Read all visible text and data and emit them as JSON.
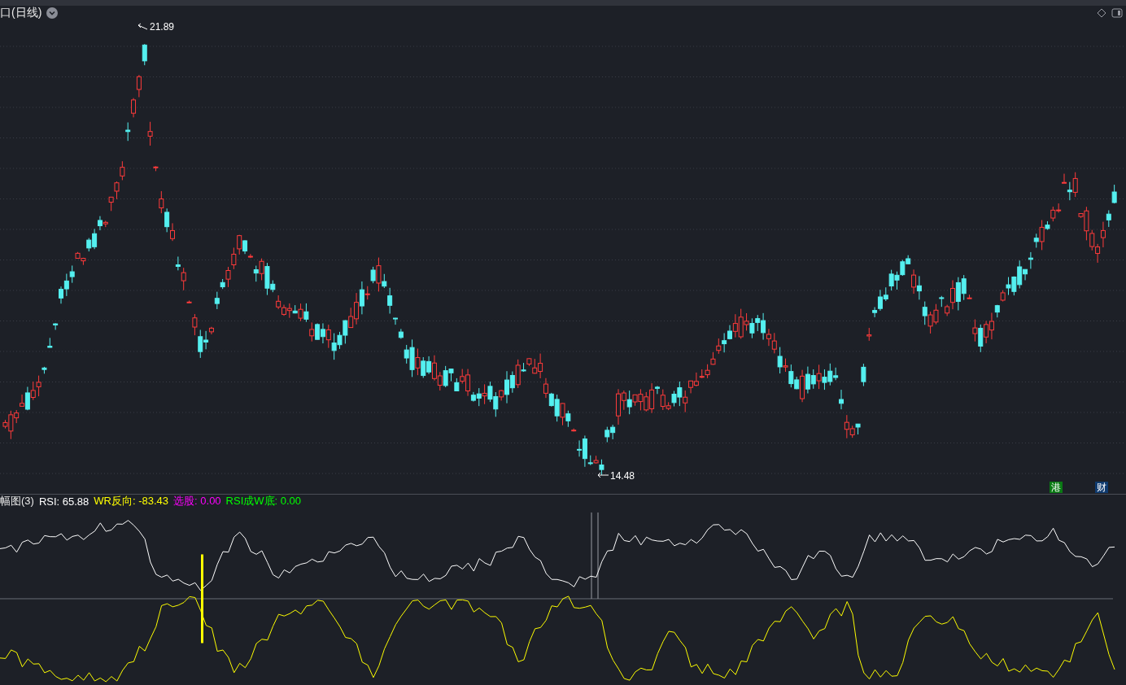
{
  "chart_title": "口(日线)",
  "high_marker": "21.89",
  "low_marker": "14.48",
  "badges": [
    {
      "label": "港",
      "color": "#0a7a14"
    },
    {
      "label": "财",
      "color": "#0f3a6e"
    }
  ],
  "indicator": {
    "name": "幅图(3)",
    "values": [
      {
        "label": "RSI:",
        "value": "65.88",
        "color": "#ffffff"
      },
      {
        "label": "WR反向:",
        "value": "-83.43",
        "color": "#ffff00"
      },
      {
        "label": "选股:",
        "value": "0.00",
        "color": "#ff00ff"
      },
      {
        "label": "RSI成W底:",
        "value": "0.00",
        "color": "#00ff00"
      }
    ]
  }
}
